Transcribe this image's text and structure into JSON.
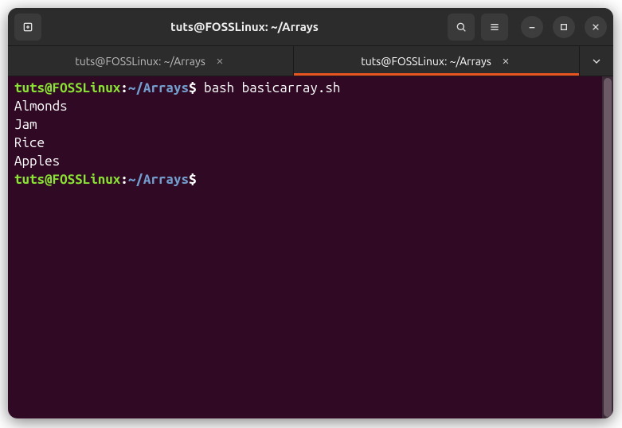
{
  "titlebar": {
    "title": "tuts@FOSSLinux: ~/Arrays"
  },
  "tabs": [
    {
      "label": "tuts@FOSSLinux: ~/Arrays",
      "active": false
    },
    {
      "label": "tuts@FOSSLinux: ~/Arrays",
      "active": true
    }
  ],
  "terminal": {
    "prompt_user": "tuts@FOSSLinux",
    "prompt_path": "~/Arrays",
    "prompt_symbol": "$",
    "lines": [
      {
        "type": "prompt_command",
        "command": "bash basicarray.sh"
      },
      {
        "type": "output",
        "text": "Almonds"
      },
      {
        "type": "output",
        "text": "Jam"
      },
      {
        "type": "output",
        "text": "Rice"
      },
      {
        "type": "output",
        "text": "Apples"
      },
      {
        "type": "prompt_command",
        "command": ""
      }
    ]
  },
  "colors": {
    "bg": "#300a24",
    "header": "#2c2c2c",
    "accent": "#e95420",
    "prompt_user": "#8ae234",
    "prompt_path": "#729fcf",
    "text": "#ffffff"
  }
}
